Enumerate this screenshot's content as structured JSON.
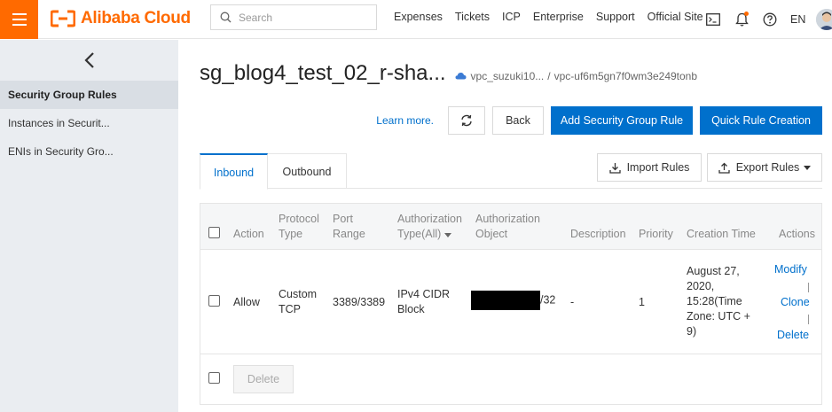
{
  "topbar": {
    "logo_text": "Alibaba Cloud",
    "search_placeholder": "Search",
    "nav": [
      "Expenses",
      "Tickets",
      "ICP",
      "Enterprise",
      "Support",
      "Official Site"
    ],
    "lang": "EN",
    "accent_color": "#ff6a00"
  },
  "sidebar": {
    "items": [
      {
        "label": "Security Group Rules",
        "active": true
      },
      {
        "label": "Instances in Securit..."
      },
      {
        "label": "ENIs in Security Gro..."
      }
    ]
  },
  "header": {
    "title": "sg_blog4_test_02_r-sha...",
    "vpc_name": "vpc_suzuki10...",
    "separator": "/",
    "vpc_id": "vpc-uf6m5gn7f0wm3e249tonb"
  },
  "actions": {
    "learn_more": "Learn more.",
    "back": "Back",
    "add_rule": "Add Security Group Rule",
    "quick_rule": "Quick Rule Creation",
    "primary_color": "#0070cc"
  },
  "tabs": {
    "inbound": "Inbound",
    "outbound": "Outbound",
    "import_rules": "Import Rules",
    "export_rules": "Export Rules"
  },
  "table": {
    "headers": {
      "action": "Action",
      "protocol_1": "Protocol",
      "protocol_2": "Type",
      "port_1": "Port",
      "port_2": "Range",
      "auth_type_1": "Authorization",
      "auth_type_2": "Type(All)",
      "auth_obj_1": "Authorization",
      "auth_obj_2": "Object",
      "description": "Description",
      "priority": "Priority",
      "creation_time": "Creation Time",
      "actions": "Actions"
    },
    "row": {
      "action": "Allow",
      "protocol_1": "Custom",
      "protocol_2": "TCP",
      "port_range": "3389/3389",
      "auth_type_1": "IPv4 CIDR",
      "auth_type_2": "Block",
      "auth_object_suffix": "/32",
      "description": "-",
      "priority": "1",
      "time_1": "August 27,",
      "time_2": "2020,",
      "time_3": "15:28(Time",
      "time_4": "Zone: UTC +",
      "time_5": "9)",
      "modify": "Modify",
      "clone": "Clone",
      "delete": "Delete"
    },
    "footer_delete": "Delete"
  }
}
